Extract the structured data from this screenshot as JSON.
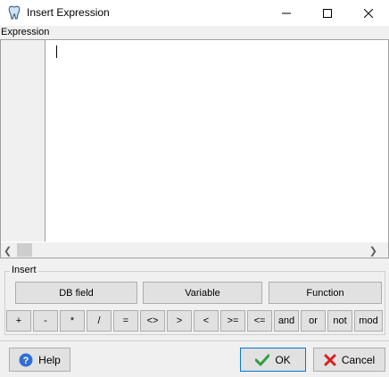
{
  "window": {
    "title": "Insert Expression",
    "icon": "tooth-icon"
  },
  "expression": {
    "label": "Expression",
    "value": ""
  },
  "insert_group": {
    "label": "Insert",
    "buttons": [
      "DB field",
      "Variable",
      "Function"
    ],
    "operators": [
      "+",
      "-",
      "*",
      "/",
      "=",
      "<>",
      ">",
      "<",
      ">=",
      "<=",
      "and",
      "or",
      "not",
      "mod"
    ]
  },
  "footer": {
    "help_label": "Help",
    "ok_label": "OK",
    "cancel_label": "Cancel"
  },
  "colors": {
    "help_icon": "#2f6fd6",
    "ok_check": "#2ea043",
    "cancel_x": "#d92020"
  }
}
